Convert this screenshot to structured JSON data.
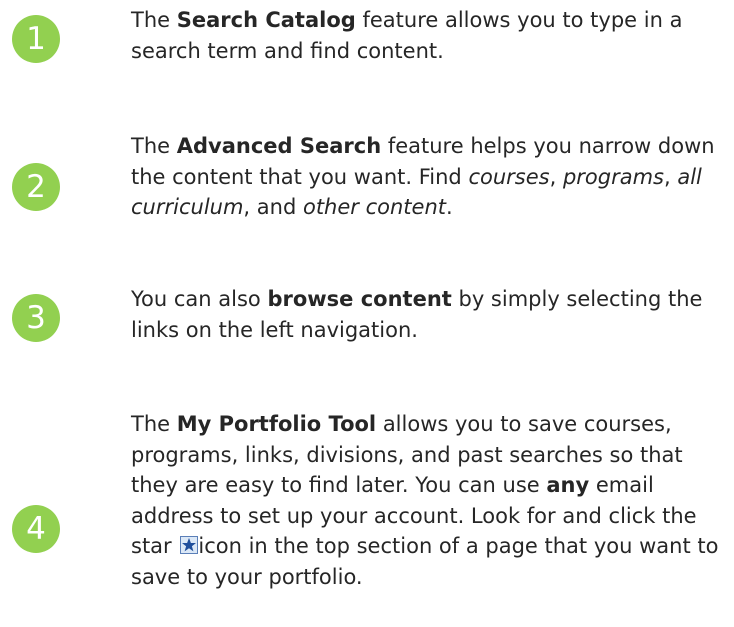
{
  "steps": [
    {
      "number": "1",
      "parts": {
        "a": "The ",
        "b": "Search Catalog",
        "c": " feature allows you to type in a search term and find content."
      }
    },
    {
      "number": "2",
      "parts": {
        "a": "The ",
        "b": "Advanced Search",
        "c": " feature helps you narrow down the content that you want.  Find ",
        "d": "courses",
        "e": ", ",
        "f": "programs",
        "g": ", ",
        "h": "all curriculum",
        "i": ", and ",
        "j": "other content",
        "k": "."
      }
    },
    {
      "number": "3",
      "parts": {
        "a": "You can also ",
        "b": "browse content",
        "c": " by simply selecting the links on the left navigation."
      }
    },
    {
      "number": "4",
      "parts": {
        "a": "The ",
        "b": "My Portfolio Tool",
        "c": " allows you to save courses, programs, links, divisions, and past searches so that they are easy to find later.  You can use ",
        "d": "any",
        "e": " email address to set up your account. Look for and click the star ",
        "f": "icon in the top section of a page that you want to save to your portfolio."
      },
      "icon": "star-icon"
    }
  ],
  "colors": {
    "badge": "#92d050",
    "text": "#262626",
    "star_fill": "#1f4e9c",
    "star_bg": "#dbe8f7"
  }
}
